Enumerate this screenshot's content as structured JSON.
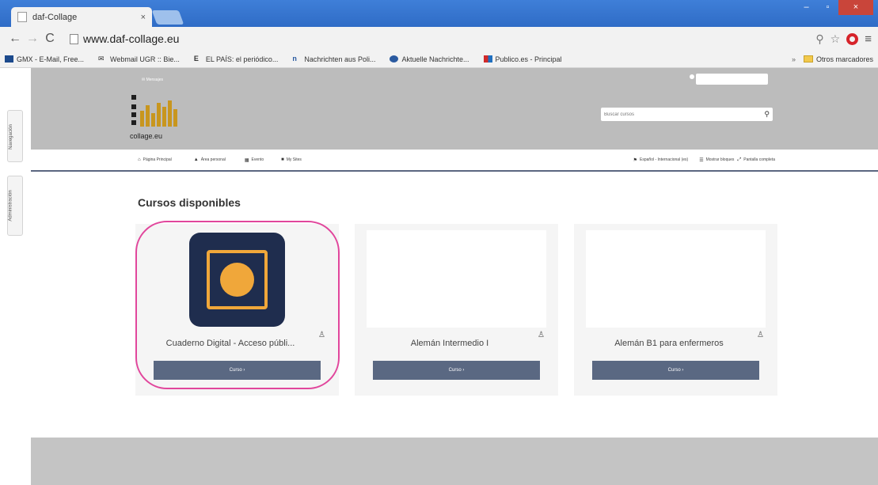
{
  "browser": {
    "tab_title": "daf-Collage",
    "tab_close": "×",
    "url": "www.daf-collage.eu",
    "window_buttons": [
      "–",
      "▫",
      "×"
    ],
    "bookmarks": [
      {
        "label": "GMX - E-Mail, Free...",
        "icon": "gmx-icon"
      },
      {
        "label": "Webmail UGR :: Bie...",
        "icon": "webmail-icon"
      },
      {
        "label": "EL PAÍS: el periódico...",
        "icon": "elpais-icon"
      },
      {
        "label": "Nachrichten aus Poli...",
        "icon": "news-icon"
      },
      {
        "label": "Aktuelle Nachrichte...",
        "icon": "news2-icon"
      },
      {
        "label": "Publico.es - Principal",
        "icon": "publico-icon"
      }
    ],
    "bookmarks_more": "»",
    "other_bookmarks": "Otros marcadores"
  },
  "side_tabs": {
    "navigation": "Navegación",
    "administration": "Administración"
  },
  "header": {
    "messages_link": "✉ Mensajes",
    "logo_text": "collage.eu",
    "search_placeholder": "Buscar cursos"
  },
  "navbar": {
    "home": "Página Principal",
    "personal_area": "Área personal",
    "events": "Evento",
    "my_sites": "My Sites",
    "language": "Español - Internacional (es)",
    "show_blocks": "Mostrar bloques",
    "fullscreen": "Pantalla completa"
  },
  "main": {
    "title": "Cursos disponibles",
    "courses": [
      {
        "name": "Cuaderno Digital - Acceso públi...",
        "button": "Curso ›",
        "has_image": true
      },
      {
        "name": "Alemán Intermedio I",
        "button": "Curso ›",
        "has_image": false
      },
      {
        "name": "Alemán B1 para enfermeros",
        "button": "Curso ›",
        "has_image": false
      }
    ]
  },
  "colors": {
    "highlight": "#e1469c",
    "button": "#5a6882",
    "app_icon_bg": "#1f2d4e",
    "app_icon_fg": "#f0a73a"
  }
}
